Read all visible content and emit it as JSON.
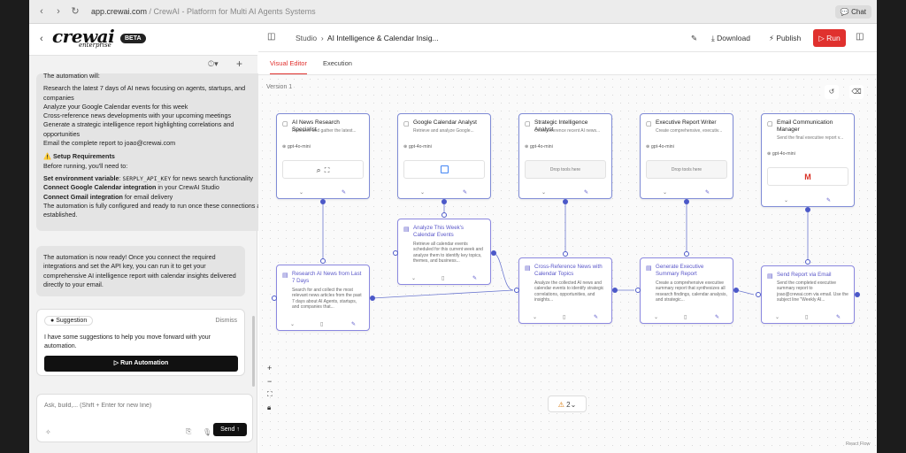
{
  "browser": {
    "url_host": "app.crewai.com",
    "url_rest": " / CrewAI - Platform for Multi AI Agents Systems",
    "chat_label": "Chat"
  },
  "sidebar": {
    "logo": "crewai",
    "logo_sub": "enterprise",
    "beta": "BETA",
    "message1": {
      "intro": "The automation will:",
      "steps": [
        "Research the latest 7 days of AI news focusing on agents, startups, and companies",
        "Analyze your Google Calendar events for this week",
        "Cross-reference news developments with your upcoming meetings",
        "Generate a strategic intelligence report highlighting correlations and opportunities",
        "Email the complete report to joao@crewai.com"
      ],
      "setup_title": "⚠️ Setup Requirements",
      "before": "Before running, you'll need to:",
      "env_bold": "Set environment variable",
      "env_code": "SERPLY_API_KEY",
      "env_rest": "for news search functionality",
      "gcal_bold": "Connect Google Calendar integration",
      "gcal_rest": "in your CrewAI Studio",
      "gmail_bold": "Connect Gmail integration",
      "gmail_rest": "for email delivery",
      "final": "The automation is fully configured and ready to run once these connections are established."
    },
    "message2": "The automation is now ready! Once you connect the required integrations and set the API key, you can run it to get your comprehensive AI intelligence report with calendar insights delivered directly to your email.",
    "suggestion": {
      "label": "Suggestion",
      "dismiss": "Dismiss",
      "text": "I have some suggestions to help you move forward with your automation.",
      "button": "Run Automation"
    },
    "input_placeholder": "Ask, build,... (Shift + Enter for new line)",
    "send_label": "Send"
  },
  "header": {
    "crumb_root": "Studio",
    "crumb_current": "AI Intelligence & Calendar Insig...",
    "download": "Download",
    "publish": "Publish",
    "run": "Run"
  },
  "tabs": [
    "Visual Editor",
    "Execution"
  ],
  "canvas": {
    "version": "Version 1",
    "agents": [
      {
        "title": "AI News Research Specialist",
        "desc": "Research and gather the latest...",
        "model": "gpt-4o-mini",
        "tools": ""
      },
      {
        "title": "Google Calendar Analyst",
        "desc": "Retrieve and analyze Google...",
        "model": "gpt-4o-mini",
        "tools": ""
      },
      {
        "title": "Strategic Intelligence Analyst",
        "desc": "Cross-reference recent AI news...",
        "model": "gpt-4o-mini",
        "tools": "Drop tools here"
      },
      {
        "title": "Executive Report Writer",
        "desc": "Create comprehensive, executiv...",
        "model": "gpt-4o-mini",
        "tools": "Drop tools here"
      },
      {
        "title": "Email Communication Manager",
        "desc": "Send the final executive report v...",
        "model": "gpt-4o-mini",
        "tools": ""
      }
    ],
    "tasks": [
      {
        "title": "Research AI News from Last 7 Days",
        "desc": "Search for and collect the most relevant news articles from the past 7 days about AI Agents, startups, and companies that..."
      },
      {
        "title": "Analyze This Week's Calendar Events",
        "desc": "Retrieve all calendar events scheduled for this current week and analyze them to identify key topics, themes, and business..."
      },
      {
        "title": "Cross-Reference News with Calendar Topics",
        "desc": "Analyze the collected AI news and calendar events to identify strategic correlations, opportunities, and insights..."
      },
      {
        "title": "Generate Executive Summary Report",
        "desc": "Create a comprehensive executive summary report that synthesizes all research findings, calendar analysis, and strategic..."
      },
      {
        "title": "Send Report via Email",
        "desc": "Send the completed executive summary report to joao@crewai.com via email. Use the subject line \"Weekly AI..."
      }
    ],
    "warnings": "2",
    "attribution": "React Flow"
  }
}
